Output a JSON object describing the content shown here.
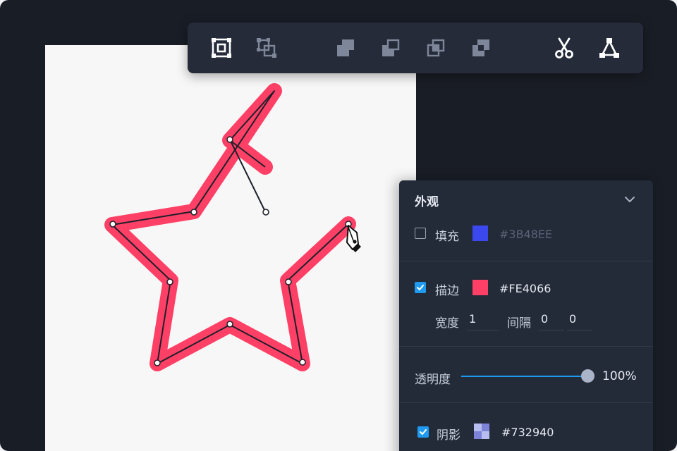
{
  "toolbar": {
    "tools": [
      {
        "name": "select-bounds-icon"
      },
      {
        "name": "group-select-icon"
      },
      {
        "name": "boolean-union-icon"
      },
      {
        "name": "boolean-subtract-icon"
      },
      {
        "name": "boolean-intersect-icon"
      },
      {
        "name": "boolean-exclude-icon"
      },
      {
        "name": "scissors-icon"
      },
      {
        "name": "path-nodes-icon"
      }
    ]
  },
  "canvas": {
    "shape": "star",
    "stroke_color": "#FE4066"
  },
  "panel": {
    "title": "外观",
    "fill": {
      "label": "填充",
      "checked": false,
      "color": "#3B48EE",
      "hex": "#3B48EE"
    },
    "stroke": {
      "label": "描边",
      "checked": true,
      "color": "#FE4066",
      "hex": "#FE4066",
      "width_label": "宽度",
      "width_value": "1",
      "gap_label": "间隔",
      "gap_value_1": "0",
      "gap_value_2": "0"
    },
    "opacity": {
      "label": "透明度",
      "value_text": "100%",
      "value": 1.0
    },
    "shadow": {
      "label": "阴影",
      "checked": true,
      "hex": "#732940"
    }
  }
}
